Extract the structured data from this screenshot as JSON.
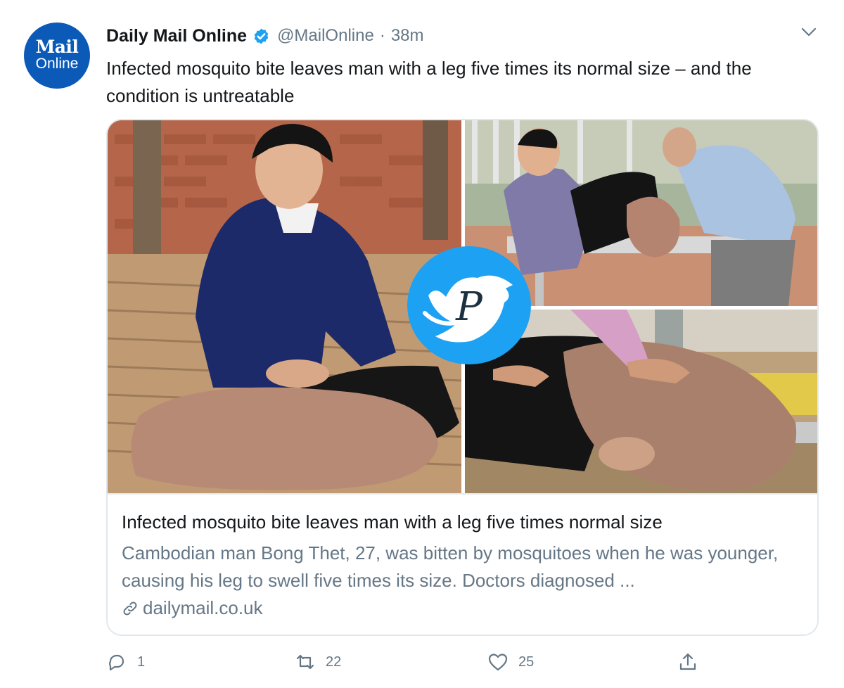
{
  "account": {
    "avatar_line1": "Mail",
    "avatar_line2": "Online",
    "display_name": "Daily Mail Online",
    "handle": "@MailOnline",
    "separator": "·",
    "time": "38m"
  },
  "tweet": {
    "text": "Infected mosquito bite leaves man with a leg five times its normal size – and the condition is untreatable"
  },
  "card": {
    "title": "Infected mosquito bite leaves man with a leg five times normal size",
    "description": "Cambodian man Bong Thet, 27, was bitten by mosquitoes when he was younger, causing his leg to swell five times its size. Doctors diagnosed ...",
    "domain": "dailymail.co.uk"
  },
  "actions": {
    "replies": "1",
    "retweets": "22",
    "likes": "25"
  },
  "colors": {
    "verified": "#1da1f2",
    "text_primary": "#14171a",
    "text_secondary": "#657786",
    "border": "#e1e8ed",
    "avatar_bg": "#0b5ab8"
  },
  "icons": [
    "verified-badge-icon",
    "chevron-down-icon",
    "link-icon",
    "reply-icon",
    "retweet-icon",
    "like-icon",
    "share-icon"
  ]
}
